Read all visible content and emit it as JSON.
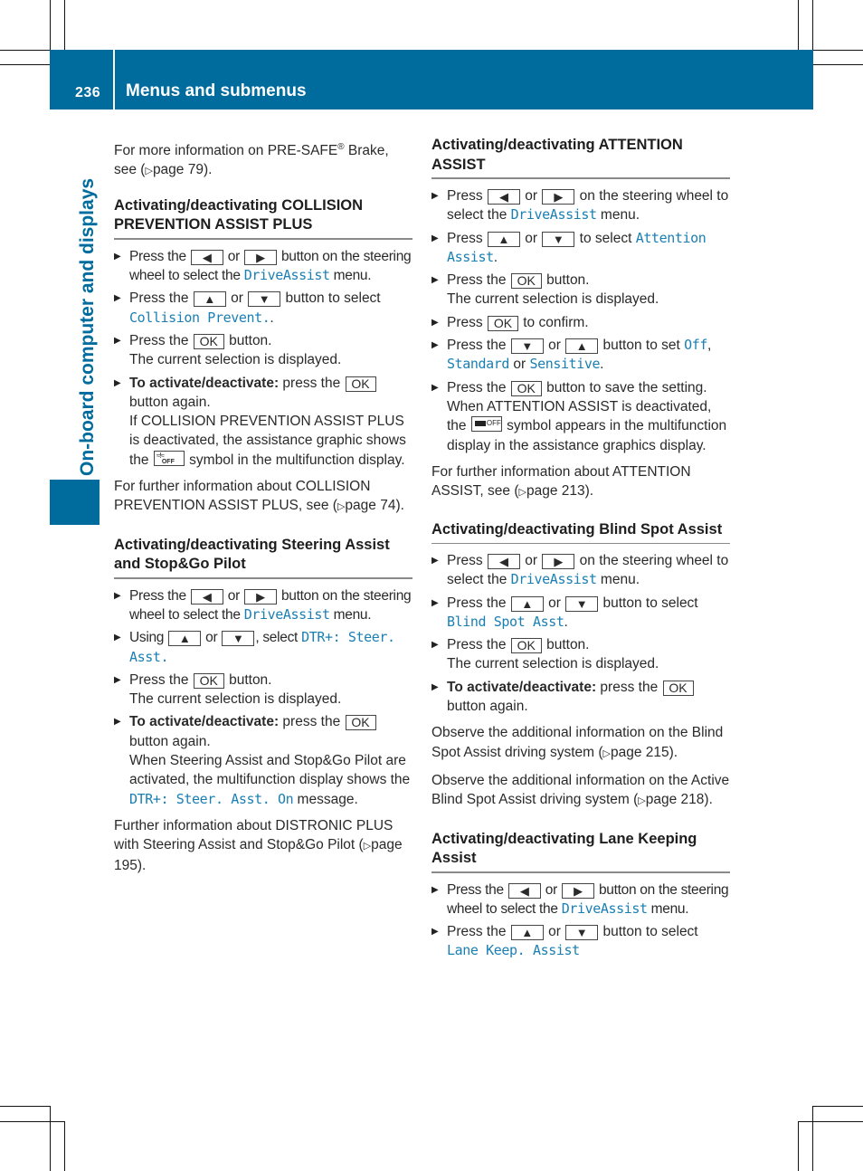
{
  "header": {
    "page_number": "236",
    "title": "Menus and submenus"
  },
  "side_tab": {
    "label": "On-board computer and displays"
  },
  "colors": {
    "brand_blue": "#006c9e",
    "display_text": "#1a7fb3"
  },
  "keys": {
    "left": "◀",
    "right": "▶",
    "up": "▲",
    "down": "▼",
    "ok": "OK"
  },
  "left_column": {
    "intro": {
      "text_a": "For more information on PRE-SAFE",
      "reg": "®",
      "text_b": " Brake, see (",
      "ref": "page 79",
      "text_c": ")."
    },
    "collision": {
      "heading": "Activating/deactivating COLLISION PREVENTION ASSIST PLUS",
      "step1": {
        "a": "Press the ",
        "or": " or ",
        "b": " button on the steering wheel to select the ",
        "menu": "DriveAssist",
        "c": " menu."
      },
      "step2": {
        "a": "Press the ",
        "or": " or ",
        "b": " button to select ",
        "item": "Collision Prevent.",
        "c": "."
      },
      "step3": {
        "a": "Press the ",
        "b": " button.",
        "c": "The current selection is displayed."
      },
      "step4": {
        "bold": "To activate/deactivate:",
        "a": " press the ",
        "b": " button again.",
        "c": "If COLLISION PREVENTION ASSIST PLUS is deactivated, the assistance graphic shows the ",
        "symbol": "collision-prevention-off-symbol",
        "symbol_text": "OFF",
        "d": " symbol in the multifunction display."
      },
      "footer": {
        "a": "For further information about COLLISION PREVENTION ASSIST PLUS, see (",
        "ref": "page 74",
        "b": ")."
      }
    },
    "steering": {
      "heading": "Activating/deactivating Steering Assist and Stop&Go Pilot",
      "step1": {
        "a": "Press the ",
        "or": " or ",
        "b": " button on the steering wheel to select the ",
        "menu": "DriveAssist",
        "c": " menu."
      },
      "step2": {
        "a": "Using ",
        "or": " or ",
        "b": ", select ",
        "item": "DTR+: Steer. Asst."
      },
      "step3": {
        "a": "Press the ",
        "b": " button.",
        "c": "The current selection is displayed."
      },
      "step4": {
        "bold": "To activate/deactivate:",
        "a": " press the ",
        "b": " button again.",
        "c": "When Steering Assist and Stop&Go Pilot are activated, the multifunction display shows the ",
        "msg": "DTR+: Steer. Asst. On",
        "d": " message."
      },
      "footer": {
        "a": "Further information about DISTRONIC PLUS with Steering Assist and Stop&Go Pilot (",
        "ref": "page 195",
        "b": ")."
      }
    }
  },
  "right_column": {
    "attention": {
      "heading": "Activating/deactivating ATTENTION ASSIST",
      "step1": {
        "a": "Press ",
        "or": " or ",
        "b": " on the steering wheel to select the ",
        "menu": "DriveAssist",
        "c": " menu."
      },
      "step2": {
        "a": "Press ",
        "or": " or ",
        "b": " to select ",
        "item": "Attention Assist",
        "c": "."
      },
      "step3": {
        "a": "Press the ",
        "b": " button.",
        "c": "The current selection is displayed."
      },
      "step4": {
        "a": "Press ",
        "b": " to confirm."
      },
      "step5": {
        "a": "Press the ",
        "or": " or ",
        "b": " button to set ",
        "opt1": "Off",
        "sep1": ", ",
        "opt2": "Standard",
        "sep2": " or ",
        "opt3": "Sensitive",
        "c": "."
      },
      "step6": {
        "a": "Press the ",
        "b": " button to save the setting.",
        "c": "When ATTENTION ASSIST is deactivated, the ",
        "symbol": "attention-assist-off-symbol",
        "symbol_text": "OFF",
        "d": " symbol appears in the multifunction display in the assistance graphics display."
      },
      "footer": {
        "a": "For further information about ATTENTION ASSIST, see (",
        "ref": "page 213",
        "b": ")."
      }
    },
    "blindspot": {
      "heading": "Activating/deactivating Blind Spot Assist",
      "step1": {
        "a": "Press ",
        "or": " or ",
        "b": " on the steering wheel to select the ",
        "menu": "DriveAssist",
        "c": " menu."
      },
      "step2": {
        "a": "Press the ",
        "or": " or ",
        "b": " button to select ",
        "item": "Blind Spot Asst",
        "c": "."
      },
      "step3": {
        "a": "Press the ",
        "b": " button.",
        "c": "The current selection is displayed."
      },
      "step4": {
        "bold": "To activate/deactivate:",
        "a": " press the ",
        "b": " button again."
      },
      "note1": {
        "a": "Observe the additional information on the Blind Spot Assist driving system (",
        "ref": "page 215",
        "b": ")."
      },
      "note2": {
        "a": "Observe the additional information on the Active Blind Spot Assist driving system (",
        "ref": "page 218",
        "b": ")."
      }
    },
    "lanekeeping": {
      "heading": "Activating/deactivating Lane Keeping Assist",
      "step1": {
        "a": "Press the ",
        "or": " or ",
        "b": " button on the steering wheel to select the ",
        "menu": "DriveAssist",
        "c": " menu."
      },
      "step2": {
        "a": "Press the ",
        "or": " or ",
        "b": " button to select ",
        "item": "Lane Keep. Assist"
      }
    }
  }
}
